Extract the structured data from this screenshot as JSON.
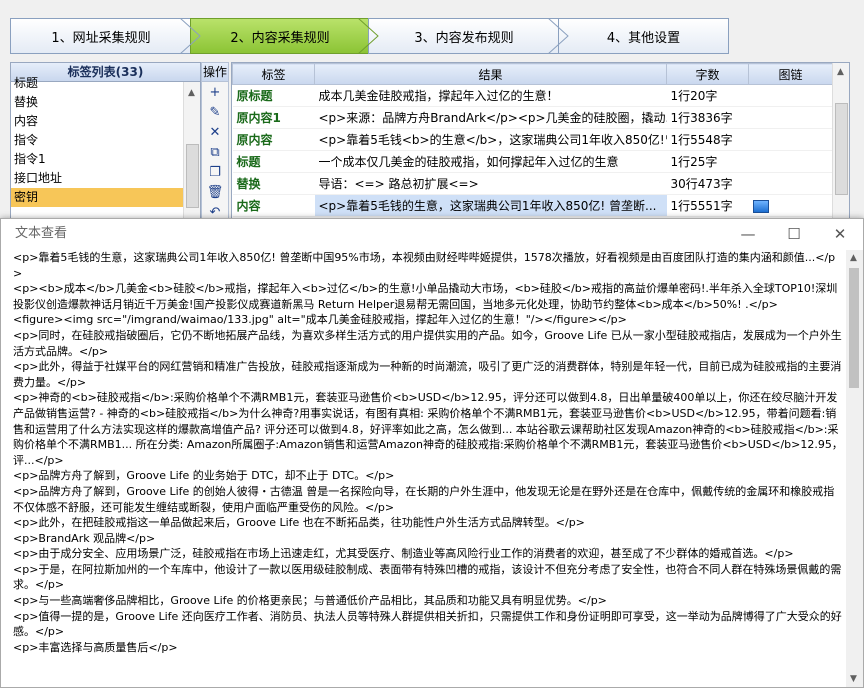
{
  "steps": [
    {
      "label": "1、网址采集规则",
      "active": false
    },
    {
      "label": "2、内容采集规则",
      "active": true
    },
    {
      "label": "3、内容发布规则",
      "active": false
    },
    {
      "label": "4、其他设置",
      "active": false
    }
  ],
  "taglist": {
    "header": "标签列表(33)",
    "items": [
      "标题",
      "替换",
      "内容",
      "指令",
      "指令1",
      "接口地址",
      "密钥"
    ],
    "selected_index": 6
  },
  "ops": {
    "header": "操作",
    "icons": [
      "plus-icon",
      "edit-icon",
      "delete-icon",
      "copy-icon",
      "duplicate-icon",
      "trash-icon",
      "undo-icon"
    ],
    "glyphs": [
      "+",
      "✎",
      "✕",
      "⧉",
      "❐",
      "🗑",
      "↶"
    ]
  },
  "grid": {
    "columns": [
      "标签",
      "结果",
      "字数",
      "图链"
    ],
    "rows": [
      {
        "tag": "原标题",
        "result": "成本几美金硅胶戒指，撑起年入过亿的生意！",
        "count": "1行20字",
        "img": ""
      },
      {
        "tag": "原内容1",
        "result": "<p>来源：品牌方舟BrandArk</p><p>几美金的硅胶圈，撬动...",
        "count": "1行3836字",
        "img": ""
      },
      {
        "tag": "原内容",
        "result": "<p>靠着5毛钱<b>的生意</b>，这家瑞典公司1年收入850亿!曾...",
        "count": "1行5548字",
        "img": ""
      },
      {
        "tag": "标题",
        "result": "一个成本仅几美金的硅胶戒指，如何撑起年入过亿的生意",
        "count": "1行25字",
        "img": ""
      },
      {
        "tag": "替换",
        "result": "导语：<=> 路总初扩展<=>",
        "count": "30行473字",
        "img": ""
      },
      {
        "tag": "内容",
        "result": "<p>靠着5毛钱的生意，这家瑞典公司1年收入850亿! 曾垄断...",
        "count": "1行5551字",
        "img": "image-icon"
      }
    ]
  },
  "viewer": {
    "title": "文本查看",
    "lines": [
      "<p>靠着5毛钱的生意，这家瑞典公司1年收入850亿! 曾垄断中国95%市场，本视频由财经哔哔姬提供，1578次播放，好看视频是由百度团队打造的集内涵和颜值...</p>",
      "<p><b>成本</b>几美金<b>硅胶</b>戒指，撑起年入<b>过亿</b>的生意!小单品撬动大市场，<b>硅胶</b>戒指的高益价爆单密码!.半年杀入全球TOP10!深圳投影仪创造爆款神话月销近千万美金!国产投影仪成赛道新黑马 Return Helper退易帮无需回国，当地多元化处理，协助节约整体<b>成本</b>50%! .</p>",
      "<figure><img src=\"/imgrand/waimao/133.jpg\" alt=\"成本几美金硅胶戒指，撑起年入过亿的生意！\"/></figure></p>",
      "<p>同时，在硅胶戒指破圈后，它仍不断地拓展产品线，为喜欢多样生活方式的用户提供实用的产品。如今，Groove Life 已从一家小型硅胶戒指店，发展成为一个户外生活方式品牌。</p>",
      "<p>此外，得益于社媒平台的网红营销和精准广告投放，硅胶戒指逐渐成为一种新的时尚潮流，吸引了更广泛的消费群体，特别是年轻一代，目前已成为硅胶戒指的主要消费力量。</p>",
      "<p>神奇的<b>硅胶戒指</b>:采购价格单个不满RMB1元，套装亚马逊售价<b>USD</b>12.95，评分还可以做到4.8，日出单量破400单以上，你还在绞尽脑汁开发产品做销售运营? - 神奇的<b>硅胶戒指</b>为什么神奇?用事实说话，有图有真相: 采购价格单个不满RMB1元，套装亚马逊售价<b>USD</b>12.95，带着问题看:销售和运营用了什么方法实现这样的爆款高增值产品? 评分还可以做到4.8，好评率如此之高，怎么做到... 本站谷歌云课帮助社区发现Amazon神奇的<b>硅胶戒指</b>:采购价格单个不满RMB1... 所在分类: Amazon所属圈子:Amazon销售和运营Amazon神奇的硅胶戒指:采购价格单个不满RMB1元，套装亚马逊售价<b>USD</b>12.95，评...</p>",
      "<p>品牌方舟了解到，Groove Life 的业务始于 DTC，却不止于 DTC。</p>",
      "<p>品牌方舟了解到，Groove Life 的创始人彼得・古德温 曾是一名探险向导，在长期的户外生涯中，他发现无论是在野外还是在仓库中，佩戴传统的金属环和橡胶戒指不仅体感不舒服，还可能发生缠结或断裂，使用户面临严重受伤的风险。</p>",
      "<p>此外，在把硅胶戒指这一单品做起来后，Groove Life 也在不断拓品类，往功能性户外生活方式品牌转型。</p>",
      "<p>BrandArk 观品牌</p>",
      "<p>由于成分安全、应用场景广泛，硅胶戒指在市场上迅速走红，尤其受医疗、制造业等高风险行业工作的消费者的欢迎，甚至成了不少群体的婚戒首选。</p>",
      "<p>于是，在阿拉斯加州的一个车库中，他设计了一款以医用级硅胶制成、表面带有特殊凹槽的戒指，该设计不但充分考虑了安全性，也符合不同人群在特殊场景佩戴的需求。</p>",
      "<p>与一些高端奢侈品牌相比，Groove Life 的价格更亲民；与普通低价产品相比，其品质和功能又具有明显优势。</p>",
      "<p>值得一提的是，Groove Life 还向医疗工作者、消防员、执法人员等特殊人群提供相关折扣，只需提供工作和身份证明即可享受，这一举动为品牌博得了广大受众的好感。</p>",
      "<p>丰富选择与高质量售后</p>"
    ]
  }
}
